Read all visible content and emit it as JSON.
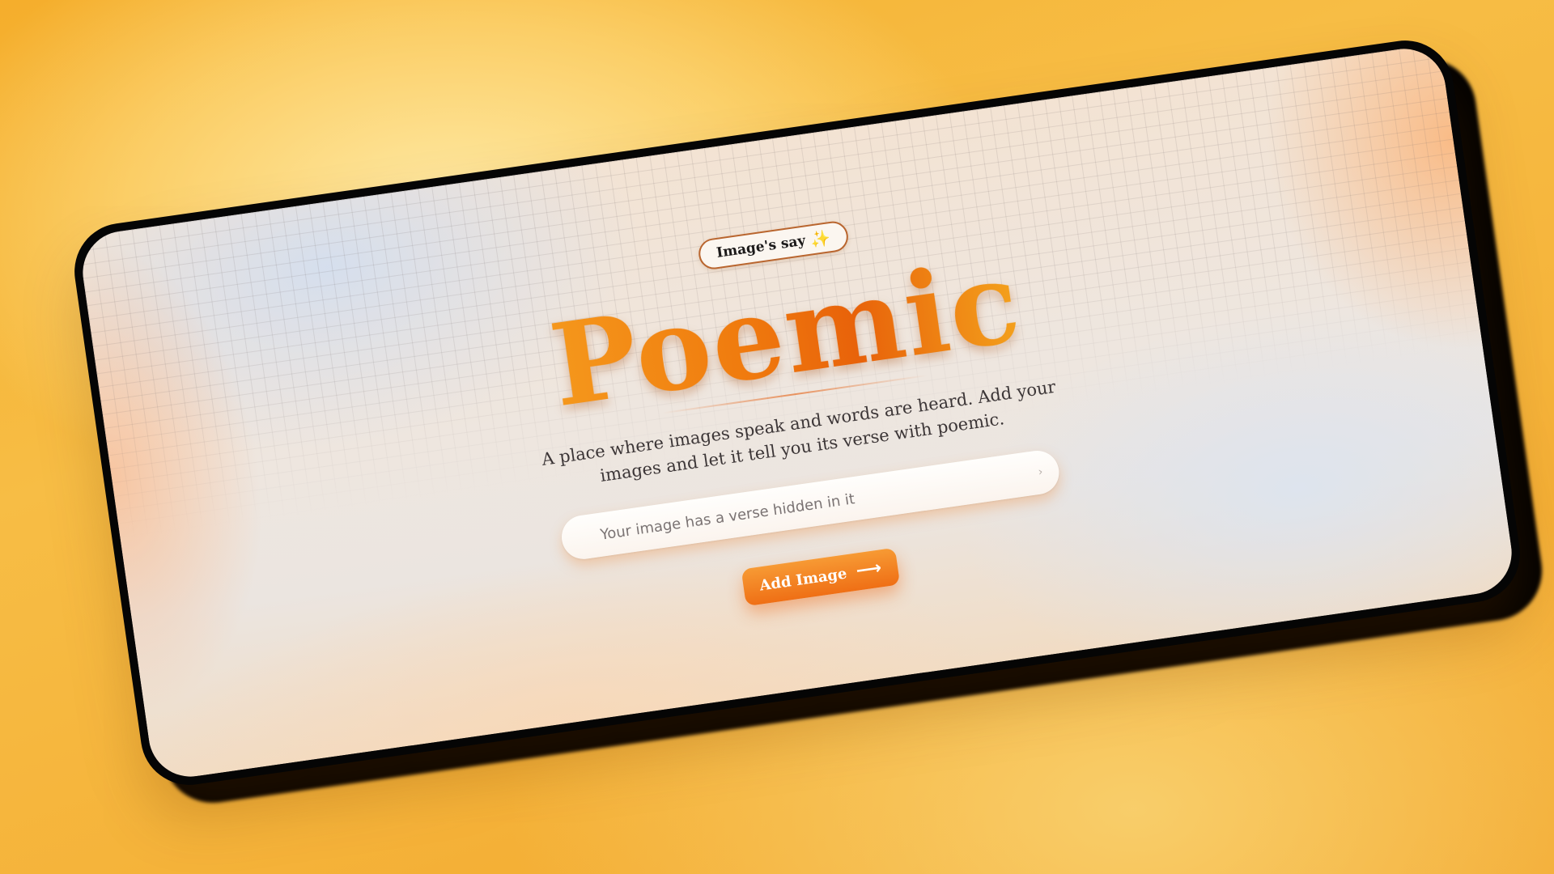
{
  "badge": {
    "label": "Image's say",
    "icon": "sparkle-icon",
    "icon_glyph": "✨"
  },
  "hero": {
    "title": "Poemic",
    "tagline": "A place where images speak and words are heard. Add your images and let it tell you its verse with poemic."
  },
  "search": {
    "placeholder": "Your image has a verse hidden in it",
    "value": "",
    "submit_icon": "chevron-right-icon",
    "submit_glyph": "›"
  },
  "cta": {
    "label": "Add Image",
    "icon": "arrow-right-icon",
    "icon_glyph": "⟶"
  },
  "colors": {
    "background": "#f5b33a",
    "accent": "#f07b0e",
    "accent_light": "#f79a34",
    "frame": "#050505",
    "badge_border": "#b9652e"
  }
}
